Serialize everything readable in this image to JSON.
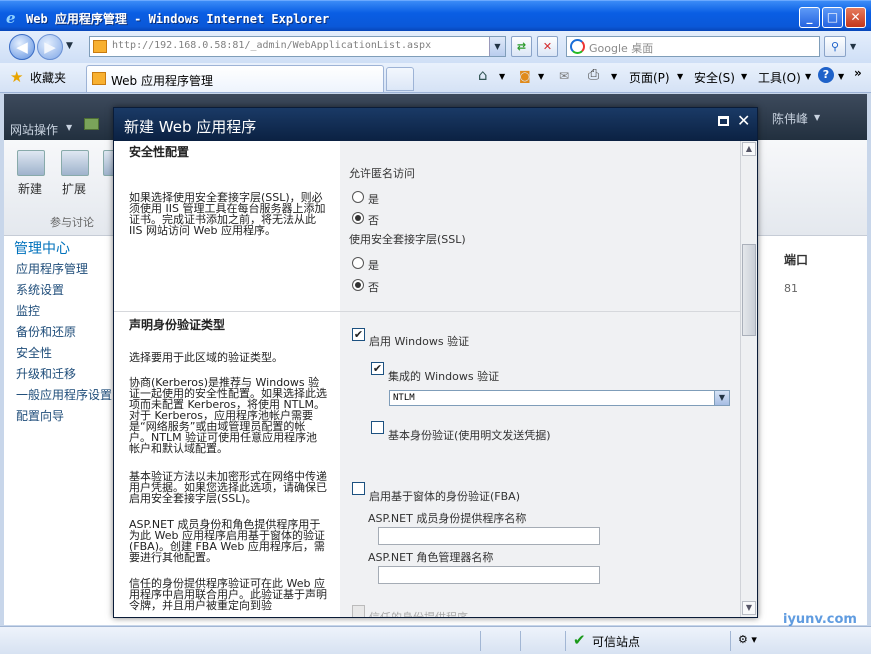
{
  "window": {
    "title": "Web 应用程序管理 - Windows Internet Explorer",
    "min": "_",
    "max": "□",
    "close": "✕"
  },
  "address": {
    "url": "http://192.168.0.58:81/_admin/WebApplicationList.aspx"
  },
  "search": {
    "placeholder": "Google 桌面"
  },
  "favorites": {
    "label": "收藏夹"
  },
  "tab": {
    "label": "Web 应用程序管理"
  },
  "toolbar": {
    "page": "页面(P)",
    "safety": "安全(S)",
    "tools": "工具(O)"
  },
  "ribbon": {
    "site_actions": "网站操作",
    "user": "陈伟峰",
    "new": "新建",
    "extend": "扩展",
    "group": "参与讨论"
  },
  "leftnav": {
    "heading": "管理中心",
    "items": [
      "应用程序管理",
      "系统设置",
      "监控",
      "备份和还原",
      "安全性",
      "升级和迁移",
      "一般应用程序设置",
      "配置向导"
    ]
  },
  "grid": {
    "port_header": "端口",
    "port_value": "81"
  },
  "dialog": {
    "title": "新建 Web 应用程序",
    "security": {
      "heading": "安全性配置",
      "desc": "如果选择使用安全套接字层(SSL)，则必须使用 IIS 管理工具在每台服务器上添加证书。完成证书添加之前，将无法从此 IIS 网站访问 Web 应用程序。",
      "anon_label": "允许匿名访问",
      "ssl_label": "使用安全套接字层(SSL)",
      "yes": "是",
      "no": "否"
    },
    "claims": {
      "heading": "声明身份验证类型",
      "p1": "选择要用于此区域的验证类型。",
      "p2": "协商(Kerberos)是推荐与 Windows 验证一起使用的安全性配置。如果选择此选项而未配置 Kerberos，将使用 NTLM。对于 Kerberos，应用程序池帐户需要是“网络服务”或由域管理员配置的帐户。NTLM 验证可使用任意应用程序池帐户和默认域配置。",
      "p3": "基本验证方法以未加密形式在网络中传递用户凭据。如果您选择此选项，请确保已启用安全套接字层(SSL)。",
      "p4": "ASP.NET 成员身份和角色提供程序用于为此 Web 应用程序启用基于窗体的验证(FBA)。创建 FBA Web 应用程序后，需要进行其他配置。",
      "p5": "信任的身份提供程序验证可在此 Web 应用程序中启用联合用户。此验证基于声明令牌，并且用户被重定向到验",
      "enable_windows": "启用 Windows 验证",
      "integrated": "集成的 Windows 验证",
      "auth_selected": "NTLM",
      "basic": "基本身份验证(使用明文发送凭据)",
      "fba": "启用基于窗体的身份验证(FBA)",
      "membership": "ASP.NET 成员身份提供程序名称",
      "role": "ASP.NET 角色管理器名称",
      "trusted": "信任的身份提供程序"
    }
  },
  "status": {
    "zone": "可信站点"
  },
  "watermark": "iyunv.com"
}
